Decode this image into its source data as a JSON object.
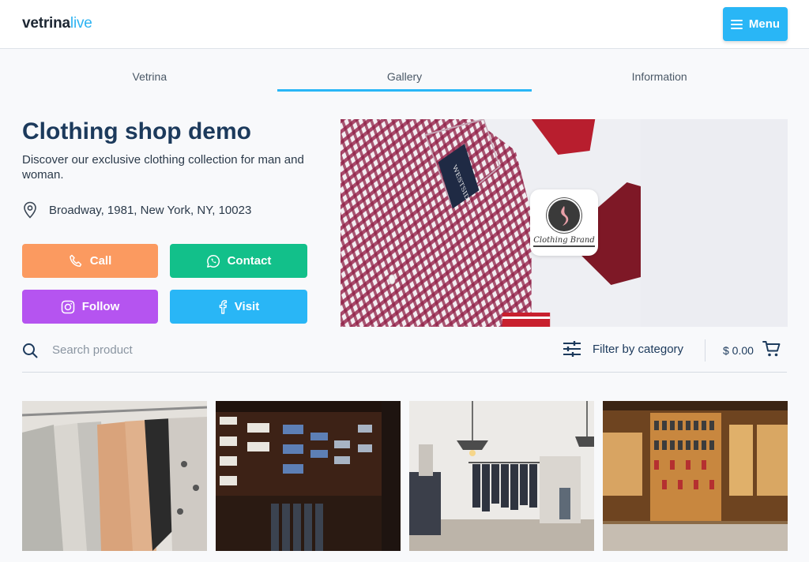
{
  "header": {
    "logo_part1": "vetrina",
    "logo_part2": "live",
    "menu_label": "Menu"
  },
  "tabs": [
    {
      "label": "Vetrina",
      "active": false
    },
    {
      "label": "Gallery",
      "active": true
    },
    {
      "label": "Information",
      "active": false
    }
  ],
  "shop": {
    "title": "Clothing shop demo",
    "description": "Discover our exclusive clothing collection for man and woman.",
    "address": "Broadway, 1981, New York, NY, 10023",
    "brand_name": "Clothing Brand"
  },
  "buttons": {
    "call": "Call",
    "contact": "Contact",
    "follow": "Follow",
    "visit": "Visit"
  },
  "search": {
    "placeholder": "Search product",
    "filter_label": "Filter by category",
    "cart_total": "$ 0.00"
  },
  "colors": {
    "accent": "#29b6f6",
    "call": "#fb9a60",
    "contact": "#12c08a",
    "follow": "#b554f0",
    "visit": "#29b6f6",
    "title": "#1c3a5c"
  },
  "icons": [
    "menu-icon",
    "location-pin-icon",
    "phone-icon",
    "whatsapp-icon",
    "instagram-icon",
    "facebook-icon",
    "search-icon",
    "filter-sliders-icon",
    "cart-icon"
  ]
}
